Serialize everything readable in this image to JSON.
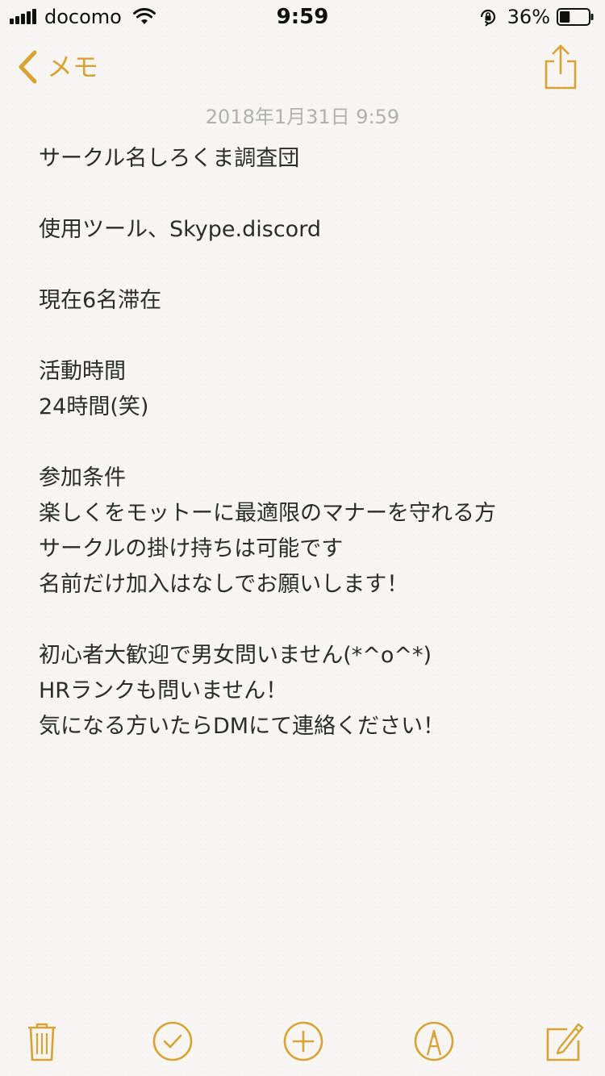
{
  "status_bar": {
    "carrier": "docomo",
    "time": "9:59",
    "battery_percent": "36%",
    "battery_level": 0.36
  },
  "nav": {
    "back_label": "メモ",
    "back_icon": "chevron-left-icon",
    "share_icon": "share-icon"
  },
  "note": {
    "date": "2018年1月31日 9:59",
    "lines": [
      "サークル名しろくま調査団",
      "",
      "使用ツール、Skype.discord",
      "",
      "現在6名滞在",
      "",
      "活動時間",
      "24時間(笑)",
      "",
      "参加条件",
      "楽しくをモットーに最適限のマナーを守れる方",
      "サークルの掛け持ちは可能です",
      "名前だけ加入はなしでお願いします！",
      "",
      "初心者大歓迎で男女問いません(*^o^*)",
      "HRランクも問いません！",
      "気になる方いたらDMにて連絡ください！"
    ]
  },
  "toolbar": {
    "icons": [
      "trash-icon",
      "checklist-icon",
      "add-icon",
      "markup-icon",
      "compose-icon"
    ]
  },
  "colors": {
    "accent": "#d7a335",
    "text": "#2b2b2b",
    "date": "#b0b0b0",
    "background": "#f7f6f3"
  }
}
